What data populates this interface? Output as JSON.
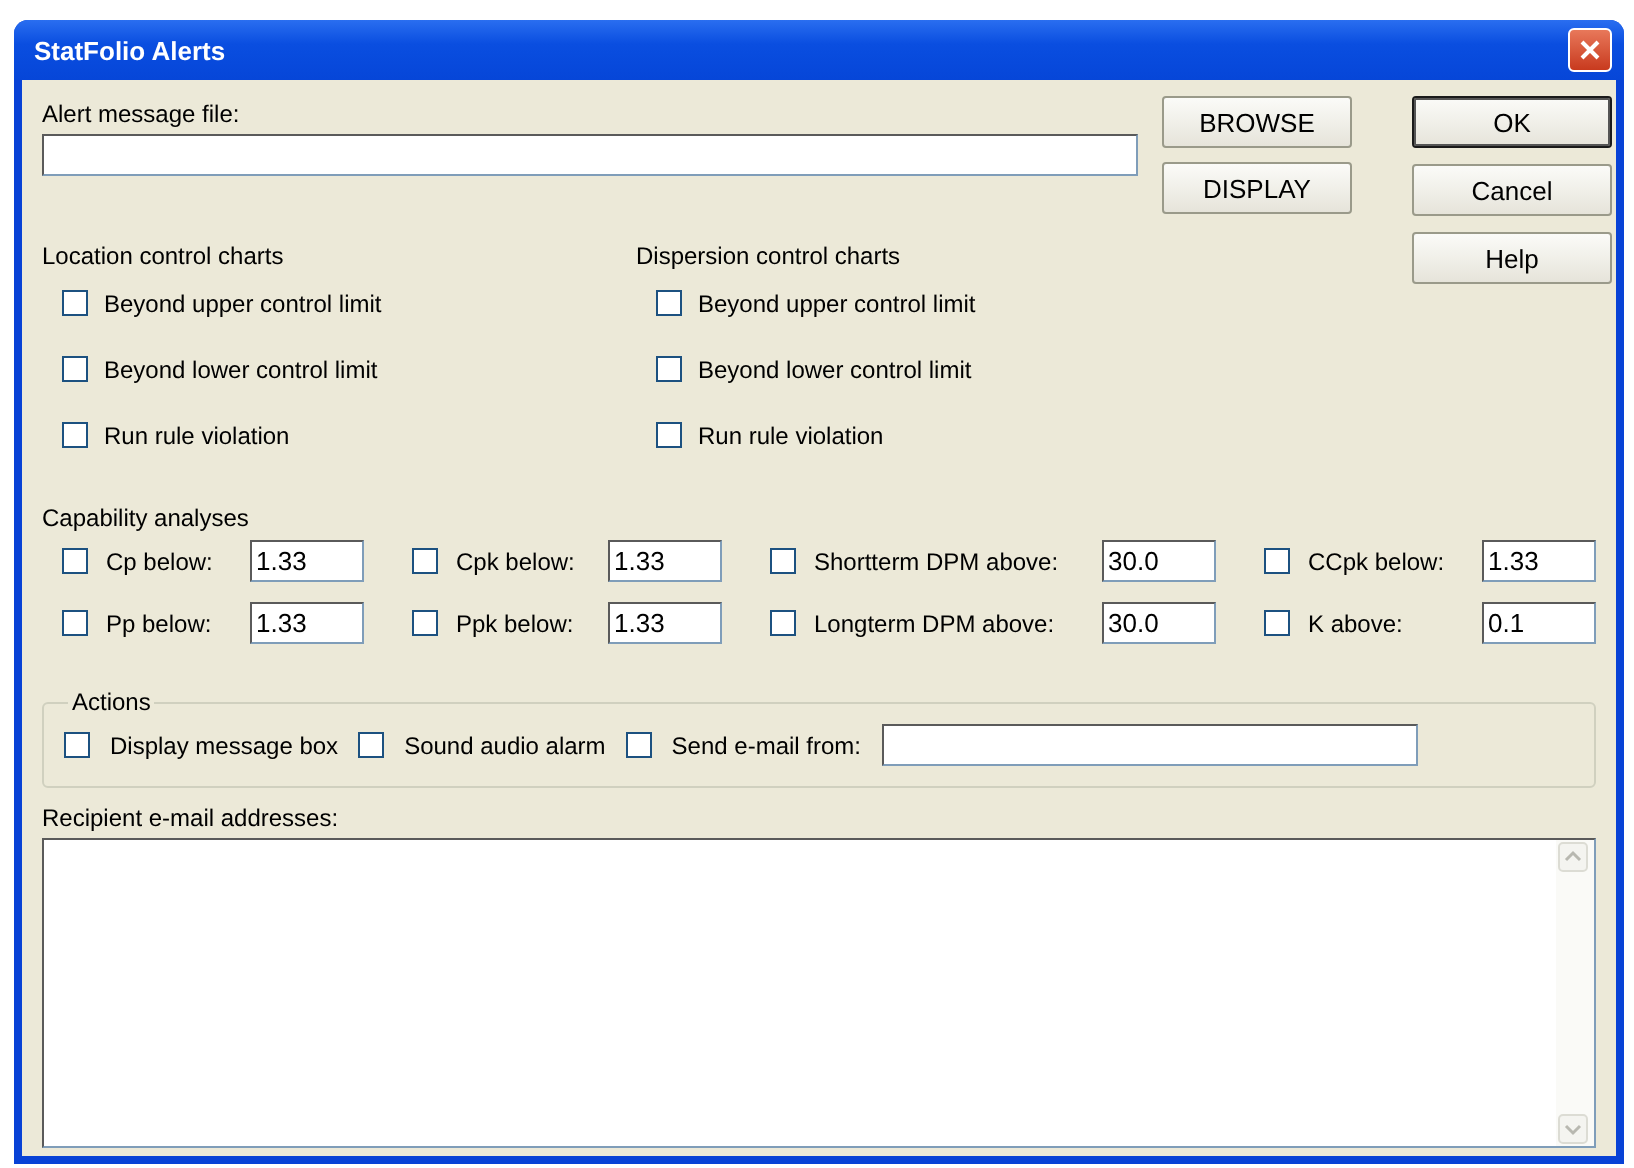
{
  "window": {
    "title": "StatFolio Alerts"
  },
  "alert_file": {
    "label": "Alert message file:"
  },
  "file_buttons": [
    {
      "label": "BROWSE"
    },
    {
      "label": "DISPLAY"
    }
  ],
  "dialog_buttons": [
    {
      "label": "OK",
      "default": true
    },
    {
      "label": "Cancel",
      "default": false
    },
    {
      "label": "Help",
      "default": false
    }
  ],
  "chart_groups": [
    {
      "title": "Location control charts",
      "items": [
        {
          "label": "Beyond upper control limit",
          "checked": false
        },
        {
          "label": "Beyond lower control limit",
          "checked": false
        },
        {
          "label": "Run rule violation",
          "checked": false
        }
      ]
    },
    {
      "title": "Dispersion control charts",
      "items": [
        {
          "label": "Beyond upper control limit",
          "checked": false
        },
        {
          "label": "Beyond lower control limit",
          "checked": false
        },
        {
          "label": "Run rule violation",
          "checked": false
        }
      ]
    }
  ],
  "capability": {
    "title": "Capability analyses",
    "items": [
      {
        "label": "Cp below:",
        "checked": false,
        "value": "1.33"
      },
      {
        "label": "Cpk below:",
        "checked": false,
        "value": "1.33"
      },
      {
        "label": "Shortterm DPM above:",
        "checked": false,
        "value": "30.0"
      },
      {
        "label": "CCpk below:",
        "checked": false,
        "value": "1.33"
      },
      {
        "label": "Pp below:",
        "checked": false,
        "value": "1.33"
      },
      {
        "label": "Ppk below:",
        "checked": false,
        "value": "1.33"
      },
      {
        "label": "Longterm DPM above:",
        "checked": false,
        "value": "30.0"
      },
      {
        "label": "K above:",
        "checked": false,
        "value": "0.1"
      }
    ]
  },
  "actions": {
    "title": "Actions",
    "items": [
      {
        "label": "Display message box",
        "checked": false
      },
      {
        "label": "Sound audio alarm",
        "checked": false
      },
      {
        "label": "Send e-mail from:",
        "checked": false
      }
    ]
  },
  "recipients": {
    "label": "Recipient e-mail addresses:"
  }
}
